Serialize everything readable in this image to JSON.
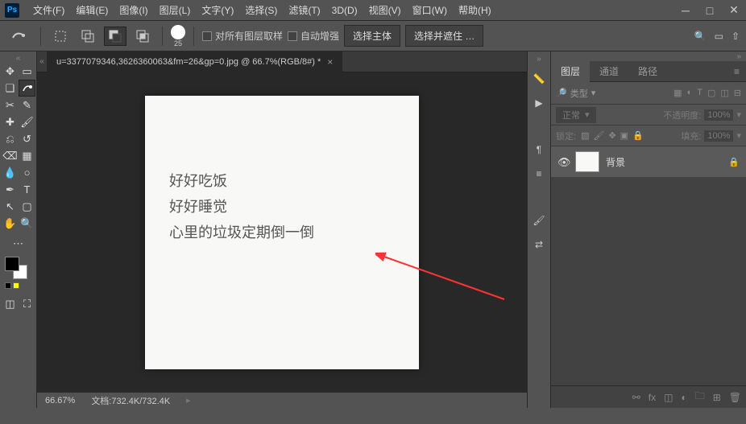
{
  "menu": [
    "文件(F)",
    "编辑(E)",
    "图像(I)",
    "图层(L)",
    "文字(Y)",
    "选择(S)",
    "滤镜(T)",
    "3D(D)",
    "视图(V)",
    "窗口(W)",
    "帮助(H)"
  ],
  "optbar": {
    "brush_size": "25",
    "sample_all": "对所有图层取样",
    "auto_enhance": "自动增强",
    "select_subject": "选择主体",
    "select_and_mask": "选择并遮住 …"
  },
  "doc": {
    "tab_title": "u=3377079346,3626360063&fm=26&gp=0.jpg @ 66.7%(RGB/8#) *",
    "canvas_lines": [
      "好好吃饭",
      "好好睡觉",
      "心里的垃圾定期倒一倒"
    ]
  },
  "panels": {
    "tabs": [
      "图层",
      "通道",
      "路径"
    ],
    "filter_label": "类型",
    "blend_mode": "正常",
    "opacity_label": "不透明度:",
    "opacity_value": "100%",
    "lock_label": "锁定:",
    "fill_label": "填充:",
    "fill_value": "100%",
    "layer_name": "背景"
  },
  "status": {
    "zoom": "66.67%",
    "doc_label": "文档:",
    "doc_size": "732.4K/732.4K"
  }
}
